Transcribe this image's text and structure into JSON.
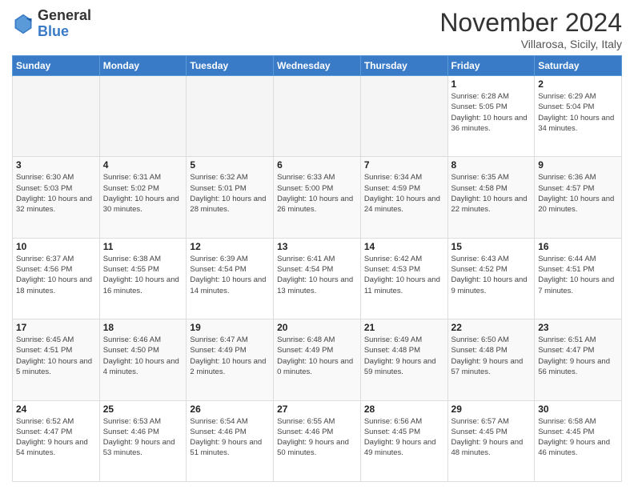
{
  "header": {
    "logo_line1": "General",
    "logo_line2": "Blue",
    "month_title": "November 2024",
    "location": "Villarosa, Sicily, Italy"
  },
  "days_of_week": [
    "Sunday",
    "Monday",
    "Tuesday",
    "Wednesday",
    "Thursday",
    "Friday",
    "Saturday"
  ],
  "weeks": [
    [
      {
        "num": "",
        "info": ""
      },
      {
        "num": "",
        "info": ""
      },
      {
        "num": "",
        "info": ""
      },
      {
        "num": "",
        "info": ""
      },
      {
        "num": "",
        "info": ""
      },
      {
        "num": "1",
        "info": "Sunrise: 6:28 AM\nSunset: 5:05 PM\nDaylight: 10 hours and 36 minutes."
      },
      {
        "num": "2",
        "info": "Sunrise: 6:29 AM\nSunset: 5:04 PM\nDaylight: 10 hours and 34 minutes."
      }
    ],
    [
      {
        "num": "3",
        "info": "Sunrise: 6:30 AM\nSunset: 5:03 PM\nDaylight: 10 hours and 32 minutes."
      },
      {
        "num": "4",
        "info": "Sunrise: 6:31 AM\nSunset: 5:02 PM\nDaylight: 10 hours and 30 minutes."
      },
      {
        "num": "5",
        "info": "Sunrise: 6:32 AM\nSunset: 5:01 PM\nDaylight: 10 hours and 28 minutes."
      },
      {
        "num": "6",
        "info": "Sunrise: 6:33 AM\nSunset: 5:00 PM\nDaylight: 10 hours and 26 minutes."
      },
      {
        "num": "7",
        "info": "Sunrise: 6:34 AM\nSunset: 4:59 PM\nDaylight: 10 hours and 24 minutes."
      },
      {
        "num": "8",
        "info": "Sunrise: 6:35 AM\nSunset: 4:58 PM\nDaylight: 10 hours and 22 minutes."
      },
      {
        "num": "9",
        "info": "Sunrise: 6:36 AM\nSunset: 4:57 PM\nDaylight: 10 hours and 20 minutes."
      }
    ],
    [
      {
        "num": "10",
        "info": "Sunrise: 6:37 AM\nSunset: 4:56 PM\nDaylight: 10 hours and 18 minutes."
      },
      {
        "num": "11",
        "info": "Sunrise: 6:38 AM\nSunset: 4:55 PM\nDaylight: 10 hours and 16 minutes."
      },
      {
        "num": "12",
        "info": "Sunrise: 6:39 AM\nSunset: 4:54 PM\nDaylight: 10 hours and 14 minutes."
      },
      {
        "num": "13",
        "info": "Sunrise: 6:41 AM\nSunset: 4:54 PM\nDaylight: 10 hours and 13 minutes."
      },
      {
        "num": "14",
        "info": "Sunrise: 6:42 AM\nSunset: 4:53 PM\nDaylight: 10 hours and 11 minutes."
      },
      {
        "num": "15",
        "info": "Sunrise: 6:43 AM\nSunset: 4:52 PM\nDaylight: 10 hours and 9 minutes."
      },
      {
        "num": "16",
        "info": "Sunrise: 6:44 AM\nSunset: 4:51 PM\nDaylight: 10 hours and 7 minutes."
      }
    ],
    [
      {
        "num": "17",
        "info": "Sunrise: 6:45 AM\nSunset: 4:51 PM\nDaylight: 10 hours and 5 minutes."
      },
      {
        "num": "18",
        "info": "Sunrise: 6:46 AM\nSunset: 4:50 PM\nDaylight: 10 hours and 4 minutes."
      },
      {
        "num": "19",
        "info": "Sunrise: 6:47 AM\nSunset: 4:49 PM\nDaylight: 10 hours and 2 minutes."
      },
      {
        "num": "20",
        "info": "Sunrise: 6:48 AM\nSunset: 4:49 PM\nDaylight: 10 hours and 0 minutes."
      },
      {
        "num": "21",
        "info": "Sunrise: 6:49 AM\nSunset: 4:48 PM\nDaylight: 9 hours and 59 minutes."
      },
      {
        "num": "22",
        "info": "Sunrise: 6:50 AM\nSunset: 4:48 PM\nDaylight: 9 hours and 57 minutes."
      },
      {
        "num": "23",
        "info": "Sunrise: 6:51 AM\nSunset: 4:47 PM\nDaylight: 9 hours and 56 minutes."
      }
    ],
    [
      {
        "num": "24",
        "info": "Sunrise: 6:52 AM\nSunset: 4:47 PM\nDaylight: 9 hours and 54 minutes."
      },
      {
        "num": "25",
        "info": "Sunrise: 6:53 AM\nSunset: 4:46 PM\nDaylight: 9 hours and 53 minutes."
      },
      {
        "num": "26",
        "info": "Sunrise: 6:54 AM\nSunset: 4:46 PM\nDaylight: 9 hours and 51 minutes."
      },
      {
        "num": "27",
        "info": "Sunrise: 6:55 AM\nSunset: 4:46 PM\nDaylight: 9 hours and 50 minutes."
      },
      {
        "num": "28",
        "info": "Sunrise: 6:56 AM\nSunset: 4:45 PM\nDaylight: 9 hours and 49 minutes."
      },
      {
        "num": "29",
        "info": "Sunrise: 6:57 AM\nSunset: 4:45 PM\nDaylight: 9 hours and 48 minutes."
      },
      {
        "num": "30",
        "info": "Sunrise: 6:58 AM\nSunset: 4:45 PM\nDaylight: 9 hours and 46 minutes."
      }
    ]
  ]
}
